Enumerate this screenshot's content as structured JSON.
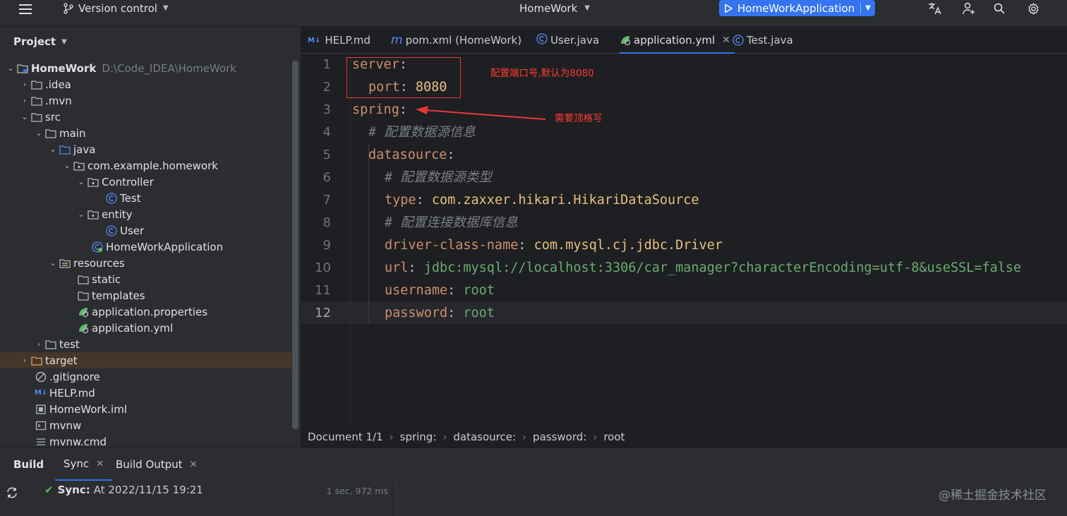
{
  "topbar": {
    "vcs_label": "Version control",
    "project_name": "HomeWork",
    "run_config": "HomeWorkApplication"
  },
  "sidebar": {
    "title": "Project",
    "tree": [
      {
        "label": "HomeWork",
        "path": "D:\\Code_IDEA\\HomeWork"
      },
      {
        "label": ".idea"
      },
      {
        "label": ".mvn"
      },
      {
        "label": "src"
      },
      {
        "label": "main"
      },
      {
        "label": "java"
      },
      {
        "label": "com.example.homework"
      },
      {
        "label": "Controller"
      },
      {
        "label": "Test"
      },
      {
        "label": "entity"
      },
      {
        "label": "User"
      },
      {
        "label": "HomeWorkApplication"
      },
      {
        "label": "resources"
      },
      {
        "label": "static"
      },
      {
        "label": "templates"
      },
      {
        "label": "application.properties"
      },
      {
        "label": "application.yml"
      },
      {
        "label": "test"
      },
      {
        "label": "target"
      },
      {
        "label": ".gitignore"
      },
      {
        "label": "HELP.md"
      },
      {
        "label": "HomeWork.iml"
      },
      {
        "label": "mvnw"
      },
      {
        "label": "mvnw.cmd"
      }
    ]
  },
  "tabs": [
    {
      "label": "HELP.md",
      "icon_text": "M↓"
    },
    {
      "label": "pom.xml (HomeWork)",
      "icon_text": "m"
    },
    {
      "label": "User.java"
    },
    {
      "label": "application.yml",
      "active": true
    },
    {
      "label": "Test.java"
    }
  ],
  "editor": {
    "line_numbers": [
      "1",
      "2",
      "3",
      "4",
      "5",
      "6",
      "7",
      "8",
      "9",
      "10",
      "11",
      "12"
    ],
    "lines": [
      {
        "key": "server",
        "colon": ":"
      },
      {
        "key": "port",
        "colon": ":",
        "value": "8080"
      },
      {
        "key": "spring",
        "colon": ":"
      },
      {
        "comment": "# 配置数据源信息"
      },
      {
        "key": "datasource",
        "colon": ":"
      },
      {
        "comment": "# 配置数据源类型"
      },
      {
        "key": "type",
        "colon": ":",
        "value": "com.zaxxer.hikari.HikariDataSource"
      },
      {
        "comment": "# 配置连接数据库信息"
      },
      {
        "key": "driver-class-name",
        "colon": ":",
        "value": "com.mysql.cj.jdbc.Driver"
      },
      {
        "key": "url",
        "colon": ":",
        "value": "jdbc:mysql://localhost:3306/car_manager?characterEncoding=utf-8&useSSL=false"
      },
      {
        "key": "username",
        "colon": ":",
        "value": "root"
      },
      {
        "key": "password",
        "colon": ":",
        "value": "root"
      }
    ]
  },
  "annotations": {
    "port_note": "配置端口号,默认为8080",
    "spring_note": "需要顶格写"
  },
  "breadcrumbs": [
    "Document 1/1",
    "spring:",
    "datasource:",
    "password:",
    "root"
  ],
  "bottom": {
    "title": "Build",
    "tabs": [
      "Sync",
      "Build Output"
    ],
    "sync_label": "Sync:",
    "sync_text": "At 2022/11/15 19:21",
    "sync_time": "1 sec, 972 ms"
  },
  "watermark": "@稀土掘金技术社区",
  "colors": {
    "accent": "#3574f0",
    "annotation": "#ff3b30",
    "success": "#5fb865"
  }
}
